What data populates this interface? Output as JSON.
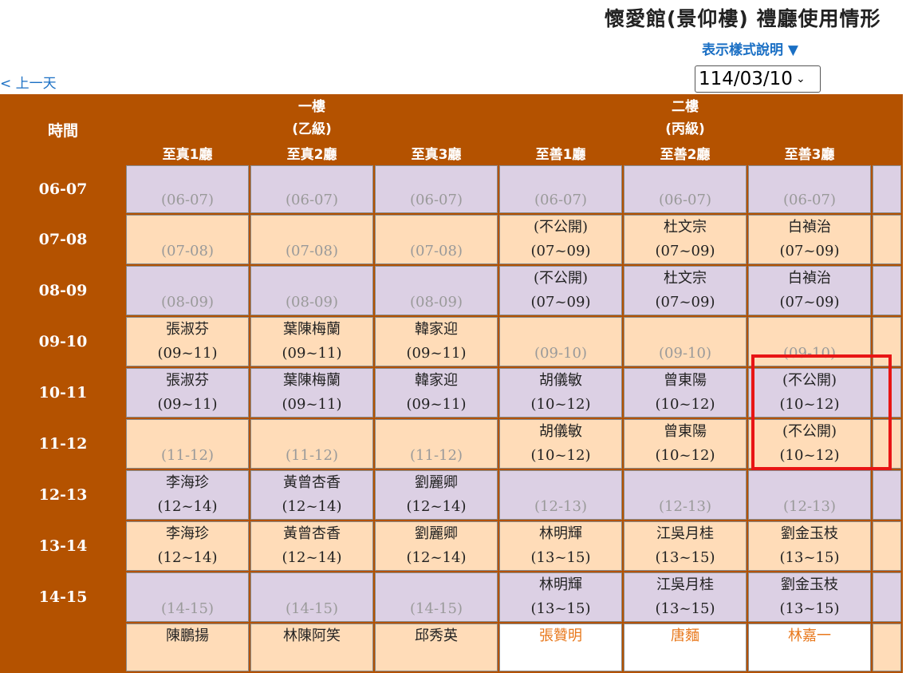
{
  "header": {
    "title": "懷愛館(景仰樓) 禮廳使用情形",
    "legend_link": "表示樣式說明 ▼",
    "prev_day": "< 上一天",
    "date_value": "114/03/10",
    "select_chevron": "chevron-down-icon"
  },
  "table": {
    "time_header": "時間",
    "floors": [
      {
        "line1": "一樓",
        "line2": "(乙級)"
      },
      {
        "line1": "二樓",
        "line2": "(丙級)"
      }
    ],
    "rooms": [
      "至真1廳",
      "至真2廳",
      "至真3廳",
      "至善1廳",
      "至善2廳",
      "至善3廳"
    ],
    "rows": [
      {
        "time": "06-07",
        "cells": [
          {
            "name": "",
            "range": "(06-07)"
          },
          {
            "name": "",
            "range": "(06-07)"
          },
          {
            "name": "",
            "range": "(06-07)"
          },
          {
            "name": "",
            "range": "(06-07)"
          },
          {
            "name": "",
            "range": "(06-07)"
          },
          {
            "name": "",
            "range": "(06-07)"
          }
        ]
      },
      {
        "time": "07-08",
        "cells": [
          {
            "name": "",
            "range": "(07-08)"
          },
          {
            "name": "",
            "range": "(07-08)"
          },
          {
            "name": "",
            "range": "(07-08)"
          },
          {
            "name": "(不公開)",
            "range": "(07~09)"
          },
          {
            "name": "杜文宗",
            "range": "(07~09)"
          },
          {
            "name": "白禎治",
            "range": "(07~09)"
          }
        ]
      },
      {
        "time": "08-09",
        "cells": [
          {
            "name": "",
            "range": "(08-09)"
          },
          {
            "name": "",
            "range": "(08-09)"
          },
          {
            "name": "",
            "range": "(08-09)"
          },
          {
            "name": "(不公開)",
            "range": "(07~09)"
          },
          {
            "name": "杜文宗",
            "range": "(07~09)"
          },
          {
            "name": "白禎治",
            "range": "(07~09)"
          }
        ]
      },
      {
        "time": "09-10",
        "cells": [
          {
            "name": "張淑芬",
            "range": "(09~11)"
          },
          {
            "name": "葉陳梅蘭",
            "range": "(09~11)"
          },
          {
            "name": "韓家迎",
            "range": "(09~11)"
          },
          {
            "name": "",
            "range": "(09-10)"
          },
          {
            "name": "",
            "range": "(09-10)"
          },
          {
            "name": "",
            "range": "(09-10)"
          }
        ]
      },
      {
        "time": "10-11",
        "cells": [
          {
            "name": "張淑芬",
            "range": "(09~11)"
          },
          {
            "name": "葉陳梅蘭",
            "range": "(09~11)"
          },
          {
            "name": "韓家迎",
            "range": "(09~11)"
          },
          {
            "name": "胡儀敏",
            "range": "(10~12)"
          },
          {
            "name": "曾東陽",
            "range": "(10~12)"
          },
          {
            "name": "(不公開)",
            "range": "(10~12)"
          }
        ]
      },
      {
        "time": "11-12",
        "cells": [
          {
            "name": "",
            "range": "(11-12)"
          },
          {
            "name": "",
            "range": "(11-12)"
          },
          {
            "name": "",
            "range": "(11-12)"
          },
          {
            "name": "胡儀敏",
            "range": "(10~12)"
          },
          {
            "name": "曾東陽",
            "range": "(10~12)"
          },
          {
            "name": "(不公開)",
            "range": "(10~12)"
          }
        ]
      },
      {
        "time": "12-13",
        "cells": [
          {
            "name": "李海珍",
            "range": "(12~14)"
          },
          {
            "name": "黃曾杏香",
            "range": "(12~14)"
          },
          {
            "name": "劉麗卿",
            "range": "(12~14)"
          },
          {
            "name": "",
            "range": "(12-13)"
          },
          {
            "name": "",
            "range": "(12-13)"
          },
          {
            "name": "",
            "range": "(12-13)"
          }
        ]
      },
      {
        "time": "13-14",
        "cells": [
          {
            "name": "李海珍",
            "range": "(12~14)"
          },
          {
            "name": "黃曾杏香",
            "range": "(12~14)"
          },
          {
            "name": "劉麗卿",
            "range": "(12~14)"
          },
          {
            "name": "林明輝",
            "range": "(13~15)"
          },
          {
            "name": "江吳月桂",
            "range": "(13~15)"
          },
          {
            "name": "劉金玉枝",
            "range": "(13~15)"
          }
        ]
      },
      {
        "time": "14-15",
        "cells": [
          {
            "name": "",
            "range": "(14-15)"
          },
          {
            "name": "",
            "range": "(14-15)"
          },
          {
            "name": "",
            "range": "(14-15)"
          },
          {
            "name": "林明輝",
            "range": "(13~15)"
          },
          {
            "name": "江吳月桂",
            "range": "(13~15)"
          },
          {
            "name": "劉金玉枝",
            "range": "(13~15)"
          }
        ]
      },
      {
        "time": "",
        "cells": [
          {
            "name": "陳鵬揚",
            "range": ""
          },
          {
            "name": "林陳阿笑",
            "range": ""
          },
          {
            "name": "邱秀英",
            "range": ""
          },
          {
            "name": "張贊明",
            "range": ""
          },
          {
            "name": "唐麵",
            "range": ""
          },
          {
            "name": "林嘉一",
            "range": ""
          }
        ]
      }
    ]
  },
  "colors": {
    "header_bg": "#b45200",
    "odd_row": "#dcd0e4",
    "even_row": "#ffdcb8",
    "highlight_box": "#e81515",
    "link": "#1a6fc4"
  }
}
